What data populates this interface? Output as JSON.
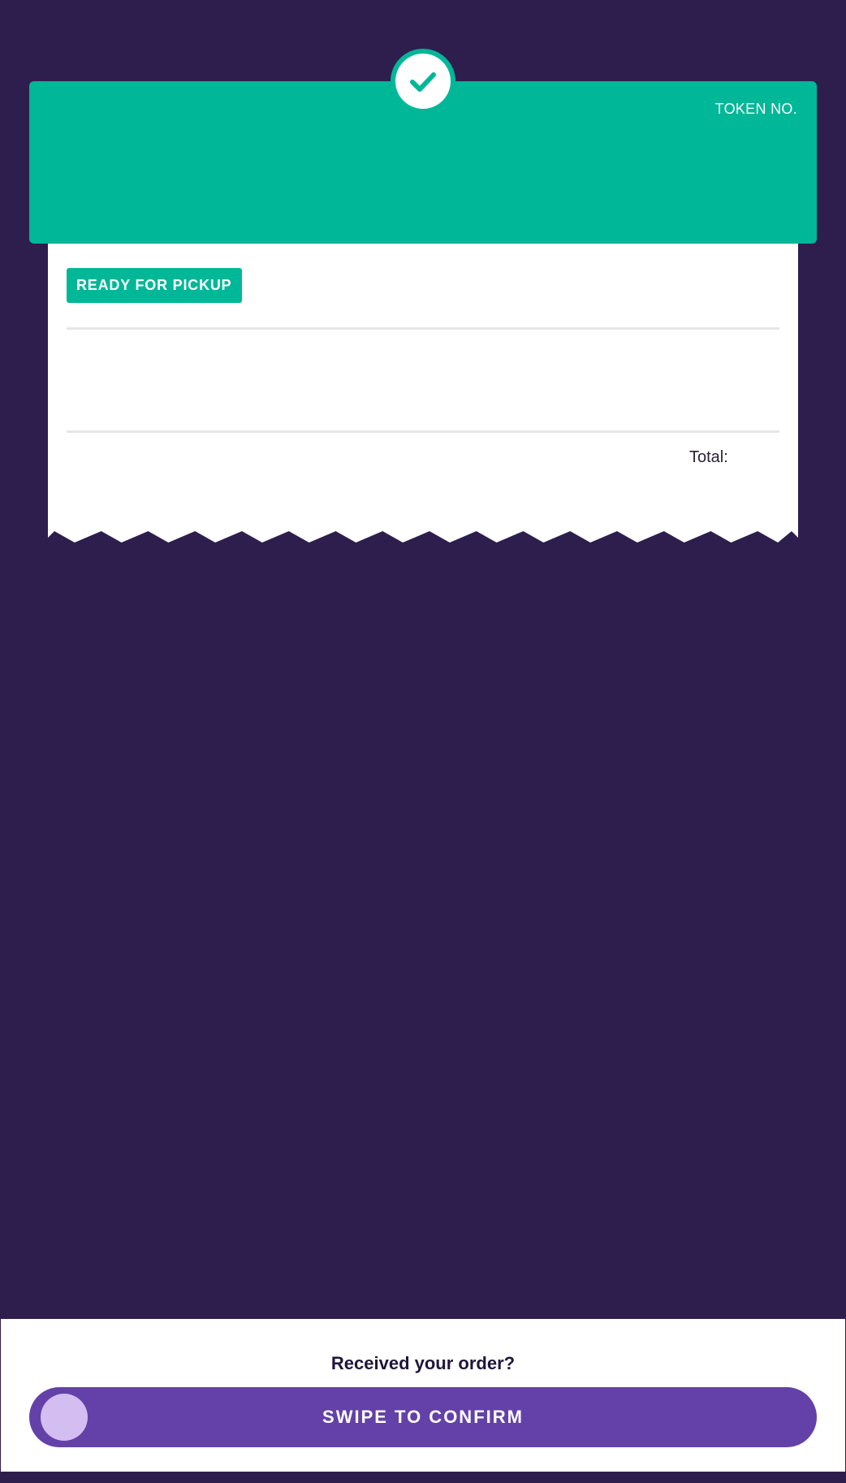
{
  "header": {
    "token_label": "TOKEN NO.",
    "token_number": ""
  },
  "icons": {
    "status": "check-icon"
  },
  "receipt": {
    "status_badge": "READY FOR PICKUP",
    "items": [],
    "total_label": "Total:",
    "total_value": ""
  },
  "confirm": {
    "question": "Received your order?",
    "swipe_label": "SWIPE TO CONFIRM"
  },
  "colors": {
    "background": "#2e1e4e",
    "accent_green": "#00b798",
    "swipe_track": "#6441a8",
    "swipe_knob": "#d4bdf1",
    "text_dark": "#20163a"
  }
}
